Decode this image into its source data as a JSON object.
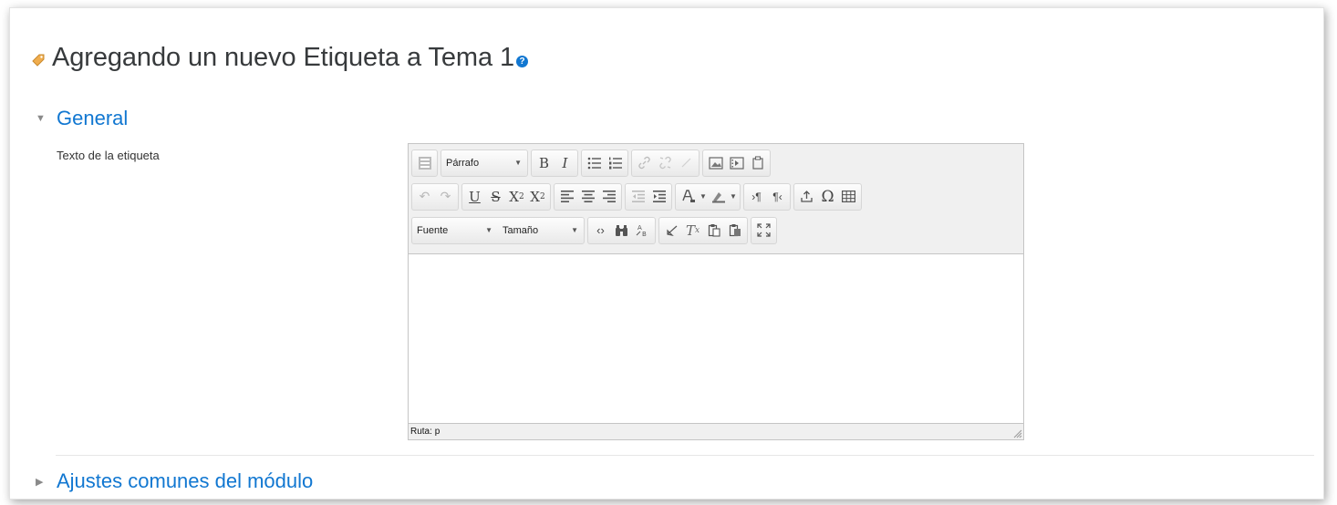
{
  "page": {
    "title": "Agregando un nuevo Etiqueta a Tema 1",
    "help_symbol": "?"
  },
  "sections": {
    "general": {
      "label": "General",
      "expanded": true
    },
    "ajustes": {
      "label": "Ajustes comunes del módulo",
      "expanded": false
    }
  },
  "field": {
    "label": "Texto de la etiqueta"
  },
  "editor": {
    "format_select": "Párrafo",
    "font_select": "Fuente",
    "size_select": "Tamaño",
    "path_label": "Ruta:",
    "path_value": "p",
    "content": ""
  },
  "colors": {
    "accent": "#1177d1",
    "title": "#373a3c",
    "tag_icon": "#f0ad4e"
  }
}
